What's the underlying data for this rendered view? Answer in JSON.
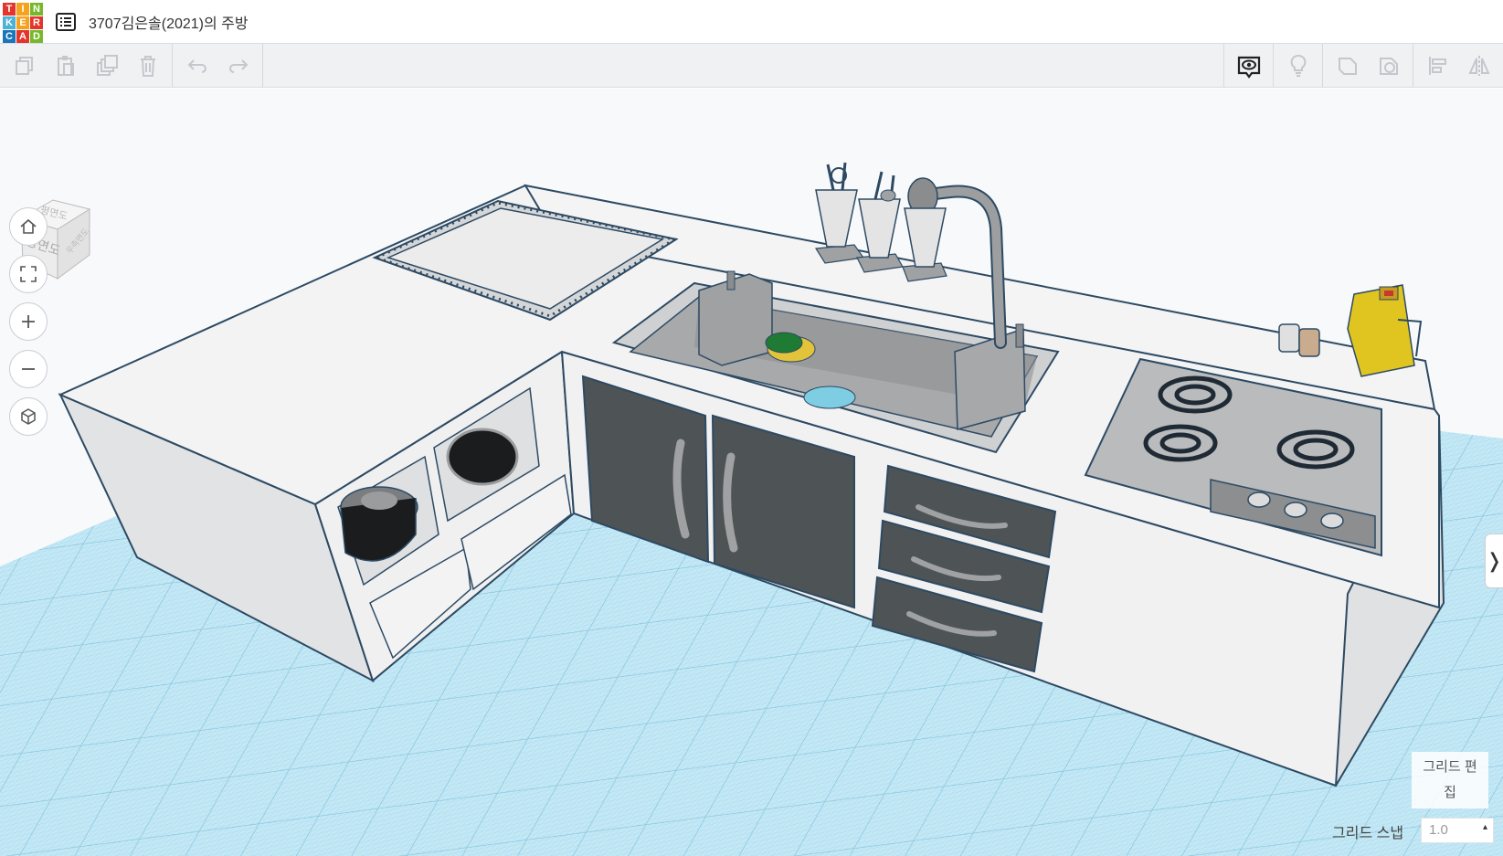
{
  "app": {
    "logo_letters": [
      "T",
      "I",
      "N",
      "K",
      "E",
      "R",
      "C",
      "A",
      "D"
    ],
    "logo_colors": [
      "#e2352b",
      "#f6a21c",
      "#76b82a",
      "#4db2d6",
      "#f6a21c",
      "#e2352b",
      "#1b75bb",
      "#e2352b",
      "#76b82a"
    ],
    "design_title": "3707김은솔(2021)의 주방"
  },
  "toolbar": {
    "left_tools": [
      "copy-icon",
      "paste-icon",
      "duplicate-icon",
      "delete-icon"
    ],
    "history_tools": [
      "undo-icon",
      "redo-icon"
    ],
    "right_tools": [
      "show-all-icon",
      "notes-icon",
      "shape-icon",
      "hole-icon",
      "align-icon",
      "mirror-icon"
    ]
  },
  "viewcube": {
    "top_label": "평면도",
    "front_label": "정면도",
    "right_label": "우측면도"
  },
  "nav": [
    "home-view-icon",
    "fit-view-icon",
    "zoom-in-icon",
    "zoom-out-icon",
    "projection-icon"
  ],
  "grid": {
    "edit_label_1": "그리드 편",
    "edit_label_2": "집",
    "snap_label": "그리드 스냅",
    "snap_value": "1.0"
  },
  "panel_toggle": "❭",
  "colors": {
    "workplane": "#bfe6f4",
    "grid_line": "#8fcbe3",
    "counter_top": "#f2f2f2",
    "cabinet_side": "#e4e5e7",
    "cabinet_dark": "#4e5356",
    "outline": "#2d4a63"
  }
}
